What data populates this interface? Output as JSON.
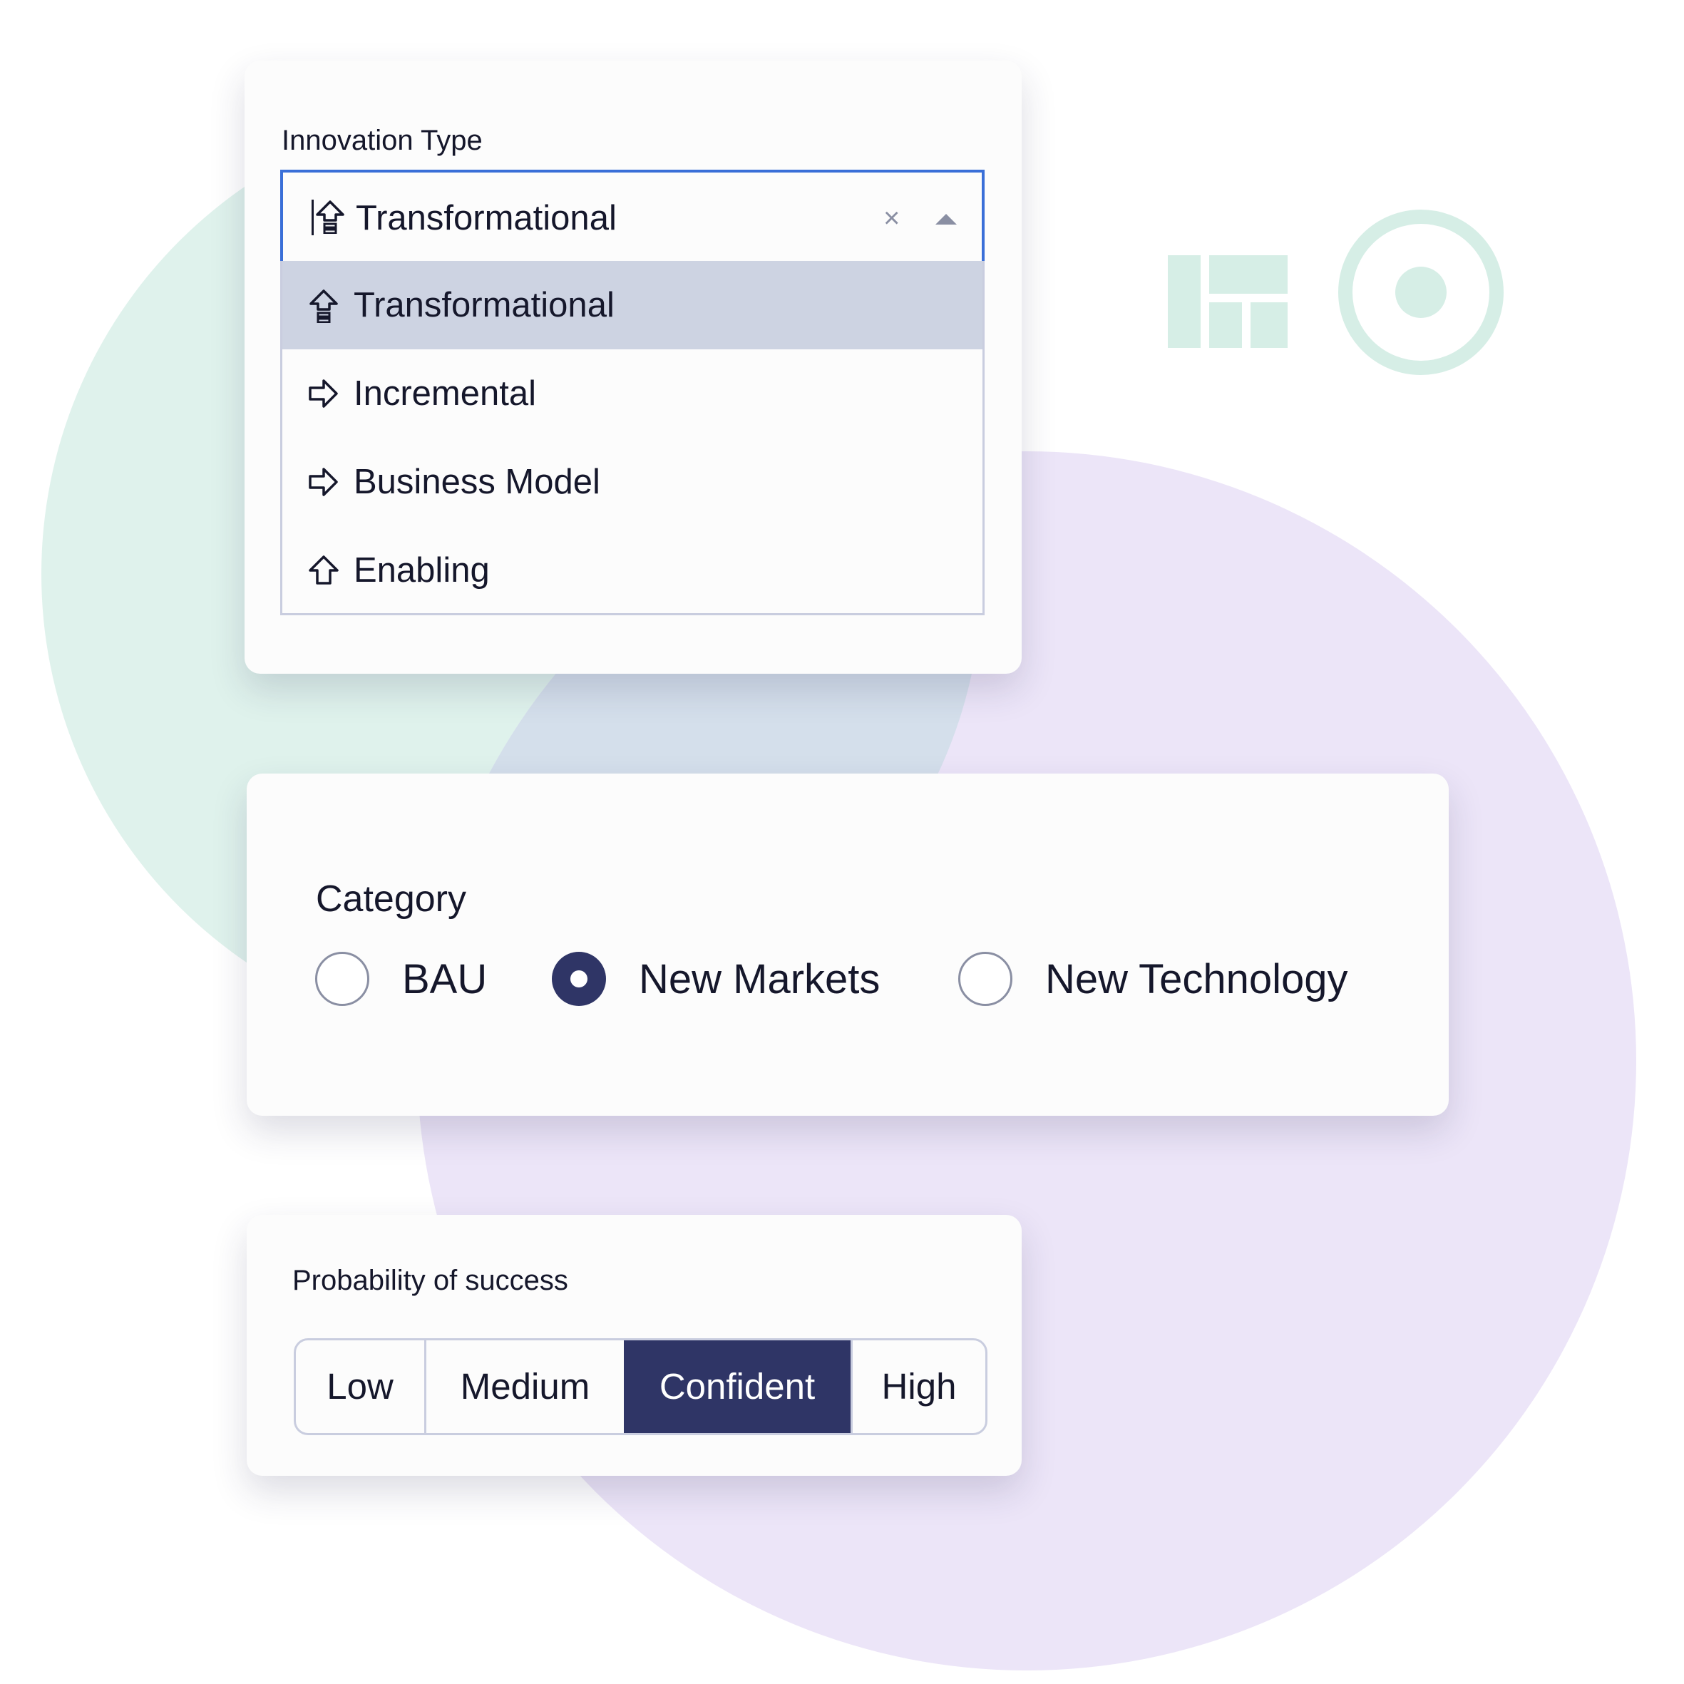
{
  "innovation_type": {
    "label": "Innovation Type",
    "selected": {
      "label": "Transformational",
      "icon": "arrow-up-stacked-icon"
    },
    "clear_icon": "×",
    "toggle_icon": "caret-up-icon",
    "options": [
      {
        "label": "Transformational",
        "icon": "arrow-up-stacked-icon",
        "selected": true
      },
      {
        "label": "Incremental",
        "icon": "arrow-right-icon",
        "selected": false
      },
      {
        "label": "Business Model",
        "icon": "arrow-right-icon",
        "selected": false
      },
      {
        "label": "Enabling",
        "icon": "arrow-up-icon",
        "selected": false
      }
    ]
  },
  "category": {
    "label": "Category",
    "options": [
      {
        "label": "BAU",
        "checked": false
      },
      {
        "label": "New Markets",
        "checked": true
      },
      {
        "label": "New Technology",
        "checked": false
      }
    ]
  },
  "probability": {
    "label": "Probability of success",
    "options": [
      {
        "label": "Low",
        "active": false
      },
      {
        "label": "Medium",
        "active": false
      },
      {
        "label": "Confident",
        "active": true
      },
      {
        "label": "High",
        "active": false
      }
    ]
  },
  "colors": {
    "accent": "#2f3566",
    "focus_border": "#3a6fd8",
    "option_highlight": "#cdd3e2",
    "mint": "#dff2ec",
    "lavender": "#ece5f8"
  }
}
